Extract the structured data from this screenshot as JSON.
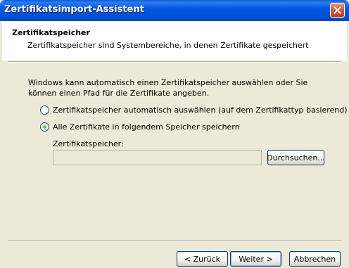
{
  "window": {
    "title": "Zertifikatsimport-Assistent"
  },
  "header": {
    "title": "Zertifikatspeicher",
    "subtitle": "Zertifikatspeicher sind Systembereiche, in denen Zertifikate gespeichert"
  },
  "body": {
    "intro": "Windows kann automatisch einen Zertifikatspeicher auswählen oder Sie können einen Pfad für die Zertifikate angeben.",
    "options": [
      {
        "label": "Zertifikatspeicher automatisch auswählen (auf dem Zertifikattyp basierend)",
        "selected": false
      },
      {
        "label": "Alle Zertifikate in folgendem Speicher speichern",
        "selected": true
      }
    ],
    "store_label": "Zertifikatspeicher:",
    "store_value": "",
    "browse_label": "Durchsuchen..."
  },
  "footer": {
    "back_label": "< Zurück",
    "next_label": "Weiter >",
    "cancel_label": "Abbrechen"
  }
}
